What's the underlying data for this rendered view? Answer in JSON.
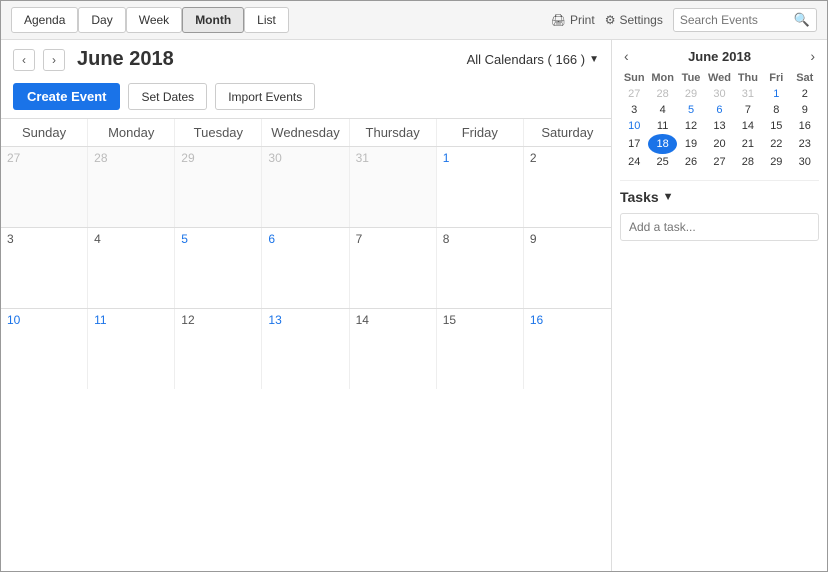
{
  "toolbar": {
    "tabs": [
      {
        "label": "Agenda",
        "active": false
      },
      {
        "label": "Day",
        "active": false
      },
      {
        "label": "Week",
        "active": false
      },
      {
        "label": "Month",
        "active": true
      },
      {
        "label": "List",
        "active": false
      }
    ],
    "print_label": "Print",
    "settings_label": "Settings",
    "search_placeholder": "Search Events"
  },
  "calendar": {
    "month_year": "June 2018",
    "all_calendars_label": "All Calendars ( 166 )",
    "create_event_label": "Create Event",
    "set_dates_label": "Set Dates",
    "import_events_label": "Import Events",
    "day_headers": [
      "Sunday",
      "Monday",
      "Tuesday",
      "Wednesday",
      "Thursday",
      "Friday",
      "Saturday"
    ],
    "weeks": [
      [
        {
          "num": "27",
          "other": true
        },
        {
          "num": "28",
          "other": true
        },
        {
          "num": "29",
          "other": true
        },
        {
          "num": "30",
          "other": true
        },
        {
          "num": "31",
          "other": true
        },
        {
          "num": "1",
          "other": false,
          "link": true
        },
        {
          "num": "2",
          "other": false
        }
      ],
      [
        {
          "num": "3",
          "other": false
        },
        {
          "num": "4",
          "other": false
        },
        {
          "num": "5",
          "other": false,
          "link": true
        },
        {
          "num": "6",
          "other": false,
          "link": true
        },
        {
          "num": "7",
          "other": false
        },
        {
          "num": "8",
          "other": false
        },
        {
          "num": "9",
          "other": false
        }
      ],
      [
        {
          "num": "10",
          "other": false,
          "link": true
        },
        {
          "num": "11",
          "other": false,
          "link": true
        },
        {
          "num": "12",
          "other": false
        },
        {
          "num": "13",
          "other": false,
          "link": true
        },
        {
          "num": "14",
          "other": false
        },
        {
          "num": "15",
          "other": false
        },
        {
          "num": "16",
          "other": false,
          "link": true
        }
      ]
    ]
  },
  "mini_cal": {
    "month_year": "June 2018",
    "day_headers": [
      "Sun",
      "Mon",
      "Tue",
      "Wed",
      "Thu",
      "Fri",
      "Sat"
    ],
    "weeks": [
      [
        {
          "num": "27",
          "other": true
        },
        {
          "num": "28",
          "other": true
        },
        {
          "num": "29",
          "other": true
        },
        {
          "num": "30",
          "other": true
        },
        {
          "num": "31",
          "other": true
        },
        {
          "num": "1",
          "other": false,
          "link": true
        },
        {
          "num": "2",
          "other": false
        }
      ],
      [
        {
          "num": "3",
          "other": false
        },
        {
          "num": "4",
          "other": false
        },
        {
          "num": "5",
          "other": false,
          "link": true
        },
        {
          "num": "6",
          "other": false,
          "link": true
        },
        {
          "num": "7",
          "other": false
        },
        {
          "num": "8",
          "other": false
        },
        {
          "num": "9",
          "other": false
        }
      ],
      [
        {
          "num": "10",
          "other": false,
          "link": true
        },
        {
          "num": "11",
          "other": false
        },
        {
          "num": "12",
          "other": false
        },
        {
          "num": "13",
          "other": false
        },
        {
          "num": "14",
          "other": false
        },
        {
          "num": "15",
          "other": false
        },
        {
          "num": "16",
          "other": false
        }
      ],
      [
        {
          "num": "17",
          "other": false
        },
        {
          "num": "18",
          "other": false,
          "today": true
        },
        {
          "num": "19",
          "other": false
        },
        {
          "num": "20",
          "other": false
        },
        {
          "num": "21",
          "other": false
        },
        {
          "num": "22",
          "other": false
        },
        {
          "num": "23",
          "other": false
        }
      ],
      [
        {
          "num": "24",
          "other": false
        },
        {
          "num": "25",
          "other": false
        },
        {
          "num": "26",
          "other": false
        },
        {
          "num": "27",
          "other": false
        },
        {
          "num": "28",
          "other": false
        },
        {
          "num": "29",
          "other": false
        },
        {
          "num": "30",
          "other": false
        }
      ]
    ]
  },
  "tasks": {
    "label": "Tasks",
    "add_placeholder": "Add a task..."
  }
}
